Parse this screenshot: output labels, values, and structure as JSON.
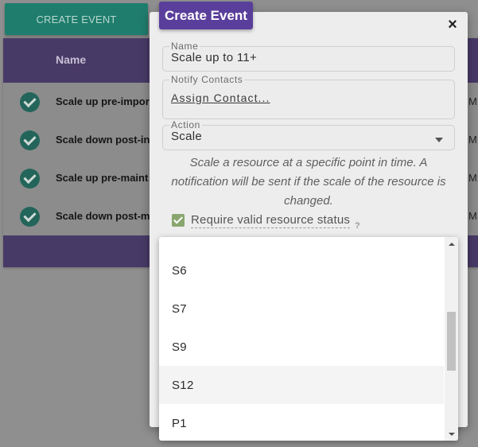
{
  "background": {
    "create_button_label": "CREATE EVENT",
    "table": {
      "name_column": "Name",
      "rows": [
        {
          "name": "Scale up pre-impor",
          "tail": "M"
        },
        {
          "name": "Scale down post-in",
          "tail": "M"
        },
        {
          "name": "Scale up pre-maint",
          "tail": "M"
        },
        {
          "name": "Scale down post-m",
          "tail": "M"
        }
      ]
    }
  },
  "modal": {
    "title": "Create Event",
    "close_symbol": "×",
    "name_field": {
      "label": "Name",
      "value": "Scale up to 11+"
    },
    "contacts_field": {
      "label": "Notify Contacts",
      "link": "Assign Contact..."
    },
    "action_field": {
      "label": "Action",
      "value": "Scale"
    },
    "description": "Scale a resource at a specific point in time. A notification will be sent if the scale of the resource is changed.",
    "require_status": {
      "label": "Require valid resource status",
      "checked": true,
      "help": "?"
    }
  },
  "dropdown": {
    "options": [
      "S6",
      "S7",
      "S9",
      "S12",
      "P1"
    ],
    "highlighted": "S12"
  },
  "colors": {
    "accent_purple": "#5a3e9b",
    "teal_button": "#1f7d6d",
    "checkbox_green": "#8aa66f"
  }
}
